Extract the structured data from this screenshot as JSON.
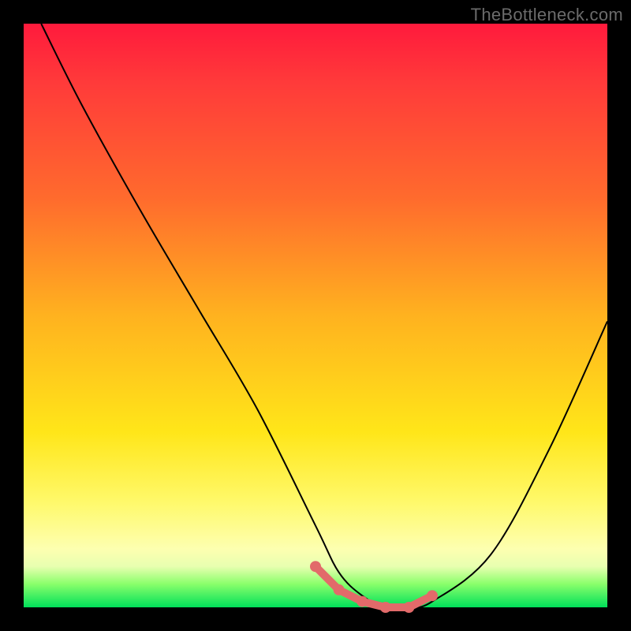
{
  "watermark": "TheBottleneck.com",
  "colors": {
    "frame": "#000000",
    "gradient_top": "#ff1a3c",
    "gradient_mid": "#ffe619",
    "gradient_bottom": "#00e05a",
    "curve": "#000000",
    "markers": "#e26a6a"
  },
  "chart_data": {
    "type": "line",
    "title": "",
    "xlabel": "",
    "ylabel": "",
    "xlim": [
      0,
      100
    ],
    "ylim": [
      0,
      100
    ],
    "series": [
      {
        "name": "bottleneck-curve",
        "x": [
          3,
          10,
          20,
          30,
          40,
          50,
          54,
          58,
          62,
          66,
          70,
          80,
          90,
          100
        ],
        "values": [
          100,
          86,
          68,
          51,
          34,
          14,
          6,
          2,
          0,
          0,
          1,
          9,
          27,
          49
        ]
      }
    ],
    "markers": {
      "name": "optimal-range",
      "x": [
        50,
        54,
        58,
        62,
        66,
        70
      ],
      "values": [
        7,
        3,
        1,
        0,
        0,
        2
      ]
    }
  }
}
